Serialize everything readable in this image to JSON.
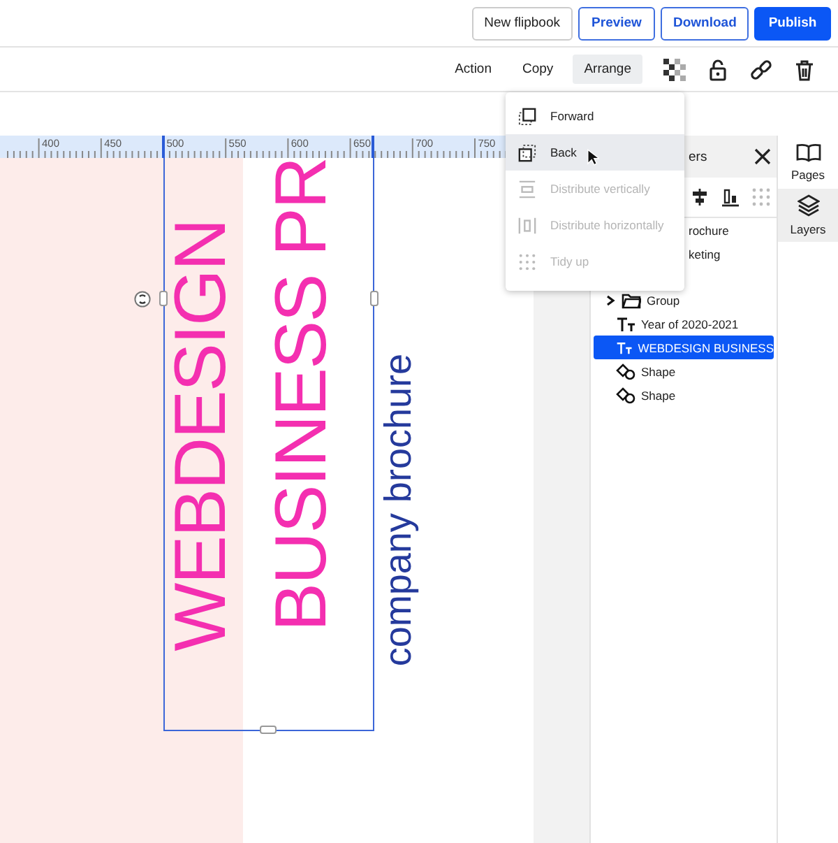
{
  "top_buttons": [
    {
      "label": "New flipbook",
      "kind": "plain"
    },
    {
      "label": "Preview",
      "kind": "outline"
    },
    {
      "label": "Download",
      "kind": "outline"
    },
    {
      "label": "Publish",
      "kind": "primary"
    }
  ],
  "toolbar": {
    "actions": [
      {
        "label": "Action",
        "selected": false
      },
      {
        "label": "Copy",
        "selected": false
      },
      {
        "label": "Arrange",
        "selected": true
      }
    ]
  },
  "ruler": {
    "labels": [
      "400",
      "450",
      "500",
      "550",
      "600",
      "650",
      "700",
      "750"
    ]
  },
  "canvas": {
    "texts": [
      {
        "text": "WEBDESIGN",
        "kind": "title"
      },
      {
        "text": "BUSINESS PR",
        "kind": "title"
      },
      {
        "text": "company brochure",
        "kind": "subtitle"
      }
    ]
  },
  "arrange_menu": [
    {
      "label": "Forward",
      "kind": "forward",
      "disabled": false,
      "selected": false
    },
    {
      "label": "Back",
      "kind": "back",
      "disabled": false,
      "selected": true
    },
    {
      "label": "Distribute vertically",
      "kind": "dist-v",
      "disabled": true,
      "selected": false
    },
    {
      "label": "Distribute horizontally",
      "kind": "dist-h",
      "disabled": true,
      "selected": false
    },
    {
      "label": "Tidy up",
      "kind": "tidy",
      "disabled": true,
      "selected": false
    }
  ],
  "layers_panel": {
    "title": "ers",
    "partial_rows": [
      "rochure",
      "keting"
    ],
    "items": [
      {
        "label": "Group",
        "kind": "group",
        "expanded": false,
        "selected": false
      },
      {
        "label": "Year of 2020-2021",
        "kind": "text",
        "selected": false
      },
      {
        "label": "WEBDESIGN BUSINESS",
        "kind": "text",
        "selected": true
      },
      {
        "label": "Shape",
        "kind": "shape",
        "selected": false
      },
      {
        "label": "Shape",
        "kind": "shape",
        "selected": false
      }
    ]
  },
  "side_tabs": [
    {
      "label": "Pages",
      "kind": "pages",
      "selected": false
    },
    {
      "label": "Layers",
      "kind": "layers",
      "selected": true
    }
  ]
}
